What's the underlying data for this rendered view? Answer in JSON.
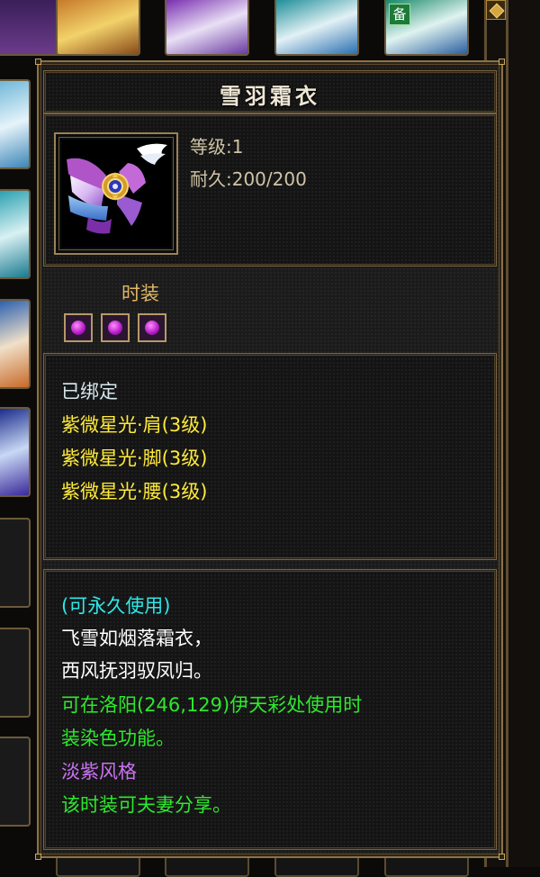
{
  "item": {
    "name": "雪羽霜衣",
    "level_label": "等级:1",
    "durability_label": "耐久:200/200",
    "category": "时装",
    "socket_count": 3
  },
  "attributes": {
    "bound": "已绑定",
    "bonuses": [
      "紫微星光·肩(3级)",
      "紫微星光·脚(3级)",
      "紫微星光·腰(3级)"
    ]
  },
  "description": {
    "usage": "(可永久使用)",
    "poem_line1": "飞雪如烟落霜衣，",
    "poem_line2": "西风抚羽驭凤归。",
    "dye_line1": "可在洛阳(246,129)伊天彩处使用时",
    "dye_line2": "装染色功能。",
    "style": "淡紫风格",
    "share": "该时装可夫妻分享。"
  },
  "background": {
    "equip_tag": "备"
  },
  "colors": {
    "frame_gold": "#8d7245",
    "text_yellow": "#ffea3a",
    "text_cyan": "#2ee8ea",
    "text_green": "#2ee82e",
    "text_purple": "#c873f0"
  }
}
